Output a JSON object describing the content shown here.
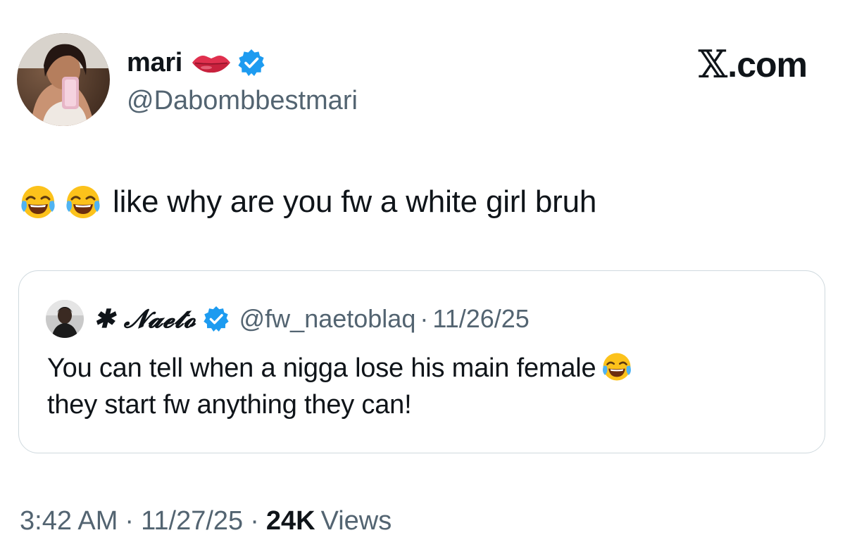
{
  "author": {
    "display_name": "mari",
    "handle": "@Dabombbestmari",
    "name_emoji": "lips-emoji",
    "verified": true
  },
  "brand": {
    "symbol": "𝕏",
    "text": ".com"
  },
  "tweet": {
    "emojis": [
      "face-with-tears-of-joy-emoji",
      "face-with-tears-of-joy-emoji"
    ],
    "text": "like why are you fw a white girl bruh"
  },
  "quote": {
    "display_name": "✱ 𝓝𝓪𝓮𝓽𝓸",
    "handle": "@fw_naetoblaq",
    "separator": "·",
    "date": "11/26/25",
    "verified": true,
    "text_line1": "You can tell when a nigga lose his main female",
    "text_line2": "they start fw anything they can!",
    "text_emoji": "face-with-tears-of-joy-emoji"
  },
  "meta": {
    "time": "3:42 AM",
    "separator": "·",
    "date": "11/27/25",
    "views_count": "24K",
    "views_label": "Views"
  },
  "colors": {
    "primary_text": "#0f1419",
    "secondary_text": "#536471",
    "verified_blue": "#1d9bf0",
    "border": "#cfd9de"
  }
}
